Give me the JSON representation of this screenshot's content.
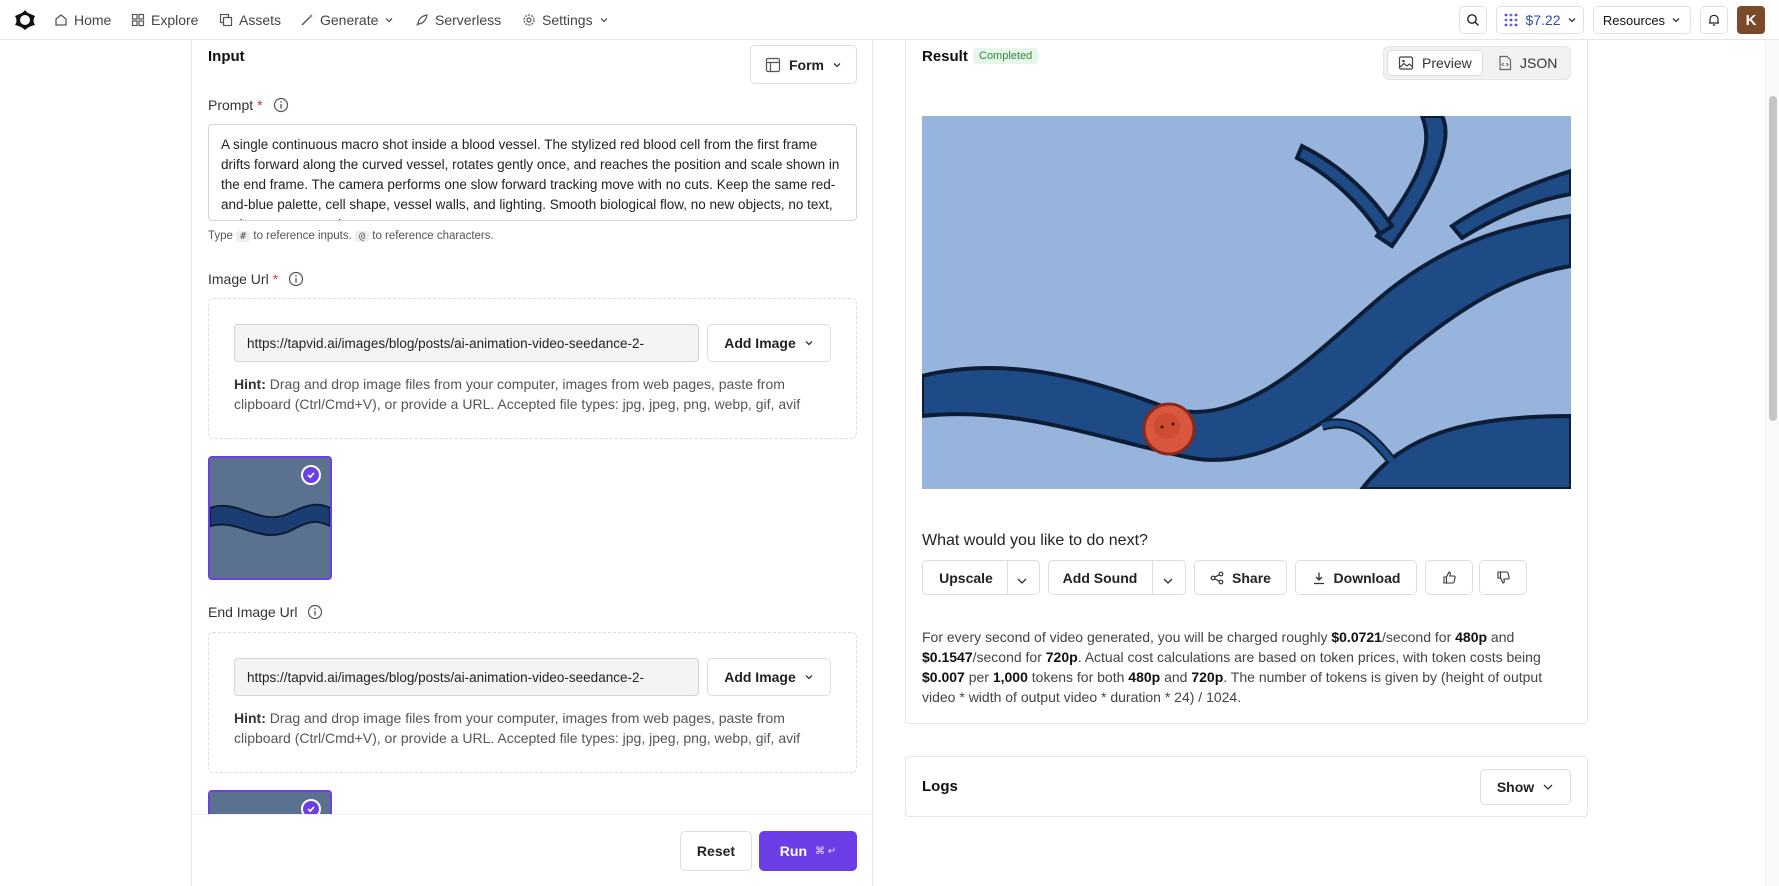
{
  "nav": {
    "home": "Home",
    "explore": "Explore",
    "assets": "Assets",
    "generate": "Generate",
    "serverless": "Serverless",
    "settings": "Settings",
    "credits": "$7.22",
    "resources": "Resources",
    "avatar_initial": "K"
  },
  "input": {
    "title": "Input",
    "mode_label": "Form",
    "prompt": {
      "label": "Prompt",
      "required_mark": "*",
      "value": "A single continuous macro shot inside a blood vessel. The stylized red blood cell from the first frame drifts forward along the curved vessel, rotates gently once, and reaches the position and scale shown in the end frame. The camera performs one slow forward tracking move with no cuts. Keep the same red-and-blue palette, cell shape, vessel walls, and lighting. Smooth biological flow, no new objects, no text, no logo, no scene change."
    },
    "reference_hint": {
      "type": "Type",
      "hash_key": "#",
      "to_inputs": "to reference inputs.",
      "at_key": "@",
      "to_characters": "to reference characters."
    },
    "image_url": {
      "label": "Image Url",
      "required_mark": "*",
      "value": "https://tapvid.ai/images/blog/posts/ai-animation-video-seedance-2-",
      "add_button": "Add Image",
      "hint_bold": "Hint:",
      "hint_text": "Drag and drop image files from your computer, images from web pages, paste from clipboard (Ctrl/Cmd+V), or provide a URL. Accepted file types: jpg, jpeg, png, webp, gif, avif"
    },
    "end_image_url": {
      "label": "End Image Url",
      "value": "https://tapvid.ai/images/blog/posts/ai-animation-video-seedance-2-",
      "add_button": "Add Image",
      "hint_bold": "Hint:",
      "hint_text": "Drag and drop image files from your computer, images from web pages, paste from clipboard (Ctrl/Cmd+V), or provide a URL. Accepted file types: jpg, jpeg, png, webp, gif, avif"
    },
    "reset_button": "Reset",
    "run_button": "Run",
    "run_shortcut": "⌘ ↵"
  },
  "result": {
    "title": "Result",
    "status": "Completed",
    "tab_preview": "Preview",
    "tab_json": "JSON",
    "next_prompt": "What would you like to do next?",
    "actions": {
      "upscale": "Upscale",
      "add_sound": "Add Sound",
      "share": "Share",
      "download": "Download"
    },
    "cost": {
      "p1": "For every second of video generated, you will be charged roughly ",
      "rate1": "$0.0721",
      "p2": "/second for ",
      "res1": "480p",
      "p3": " and ",
      "rate2": "$0.1547",
      "p4": "/second for ",
      "res2": "720p",
      "p5": ". Actual cost calculations are based on token prices, with token costs being ",
      "token_price": "$0.007",
      "p6": " per ",
      "token_count": "1,000",
      "p7": " tokens for both ",
      "res3": "480p",
      "p8": " and ",
      "res4": "720p",
      "p9": ". The number of tokens is given by (height of output video * width of output video * duration * 24) / 1024."
    }
  },
  "logs": {
    "title": "Logs",
    "toggle": "Show"
  },
  "colors": {
    "accent": "#6b3ee6",
    "sky": "#97b4dc",
    "vessel": "#1e4a86",
    "vessel_outline": "#0d1d36",
    "cell": "#d9573e",
    "thumb_bg": "#5b7190",
    "completed": "#2d8a3e"
  }
}
